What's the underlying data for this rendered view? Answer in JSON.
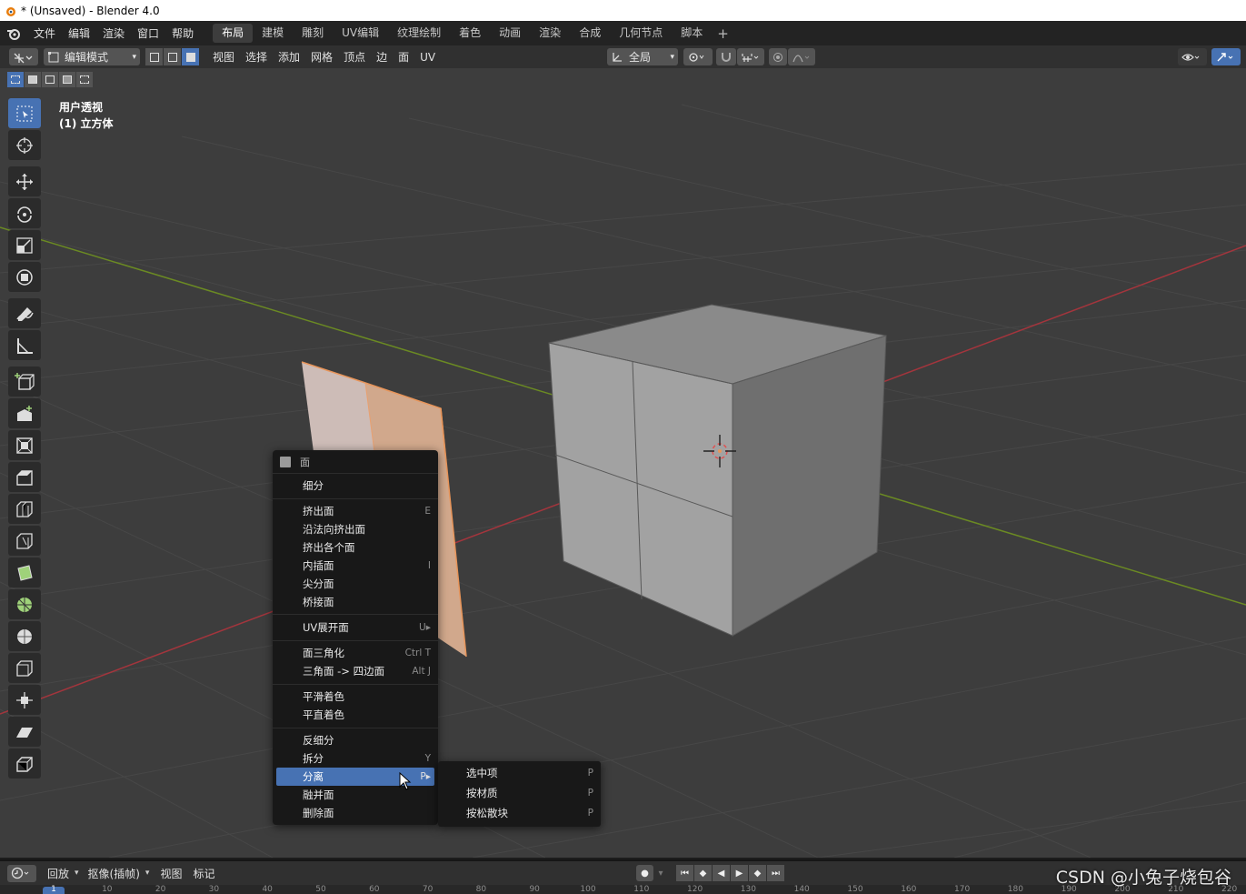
{
  "window": {
    "title": "* (Unsaved) - Blender 4.0"
  },
  "menubar": {
    "items": [
      "文件",
      "编辑",
      "渲染",
      "窗口",
      "帮助"
    ],
    "workspaces": [
      "布局",
      "建模",
      "雕刻",
      "UV编辑",
      "纹理绘制",
      "着色",
      "动画",
      "渲染",
      "合成",
      "几何节点",
      "脚本"
    ],
    "active_workspace": "布局",
    "add_workspace": "+"
  },
  "header": {
    "mode": "编辑模式",
    "menus": [
      "视图",
      "选择",
      "添加",
      "网格",
      "顶点",
      "边",
      "面",
      "UV"
    ],
    "transform_orientation": "全局"
  },
  "viewport": {
    "view_name": "用户透视",
    "object_name": "(1) 立方体"
  },
  "context_menu": {
    "title": "面",
    "groups": [
      [
        {
          "label": "细分",
          "shortcut": ""
        }
      ],
      [
        {
          "label": "挤出面",
          "shortcut": "E"
        },
        {
          "label": "沿法向挤出面",
          "shortcut": ""
        },
        {
          "label": "挤出各个面",
          "shortcut": ""
        },
        {
          "label": "内插面",
          "shortcut": "I"
        },
        {
          "label": "尖分面",
          "shortcut": ""
        },
        {
          "label": "桥接面",
          "shortcut": ""
        }
      ],
      [
        {
          "label": "UV展开面",
          "shortcut": "U▸"
        }
      ],
      [
        {
          "label": "面三角化",
          "shortcut": "Ctrl T"
        },
        {
          "label": "三角面 -> 四边面",
          "shortcut": "Alt J"
        }
      ],
      [
        {
          "label": "平滑着色",
          "shortcut": ""
        },
        {
          "label": "平直着色",
          "shortcut": ""
        }
      ],
      [
        {
          "label": "反细分",
          "shortcut": ""
        },
        {
          "label": "拆分",
          "shortcut": "Y"
        },
        {
          "label": "分离",
          "shortcut": "P▸",
          "highlighted": true
        },
        {
          "label": "融并面",
          "shortcut": ""
        },
        {
          "label": "删除面",
          "shortcut": ""
        }
      ]
    ]
  },
  "submenu": {
    "items": [
      {
        "label": "选中项",
        "shortcut": "P"
      },
      {
        "label": "按材质",
        "shortcut": "P"
      },
      {
        "label": "按松散块",
        "shortcut": "P"
      }
    ]
  },
  "timeline": {
    "menus": [
      "回放",
      "抠像(插帧)",
      "视图",
      "标记"
    ],
    "current_frame": "1",
    "ruler_labels": [
      "1",
      "10",
      "20",
      "30",
      "40",
      "50",
      "60",
      "70",
      "80",
      "90",
      "100",
      "110",
      "120",
      "130",
      "140",
      "150",
      "160",
      "170",
      "180",
      "190",
      "200",
      "210",
      "220"
    ]
  },
  "watermark": "CSDN @小兔子烧包谷",
  "colors": {
    "accent": "#4772b3",
    "viewport_bg": "#3d3d3d",
    "selection_orange": "#e8955a",
    "x_axis": "#a3353d",
    "y_axis": "#6b8a23"
  }
}
